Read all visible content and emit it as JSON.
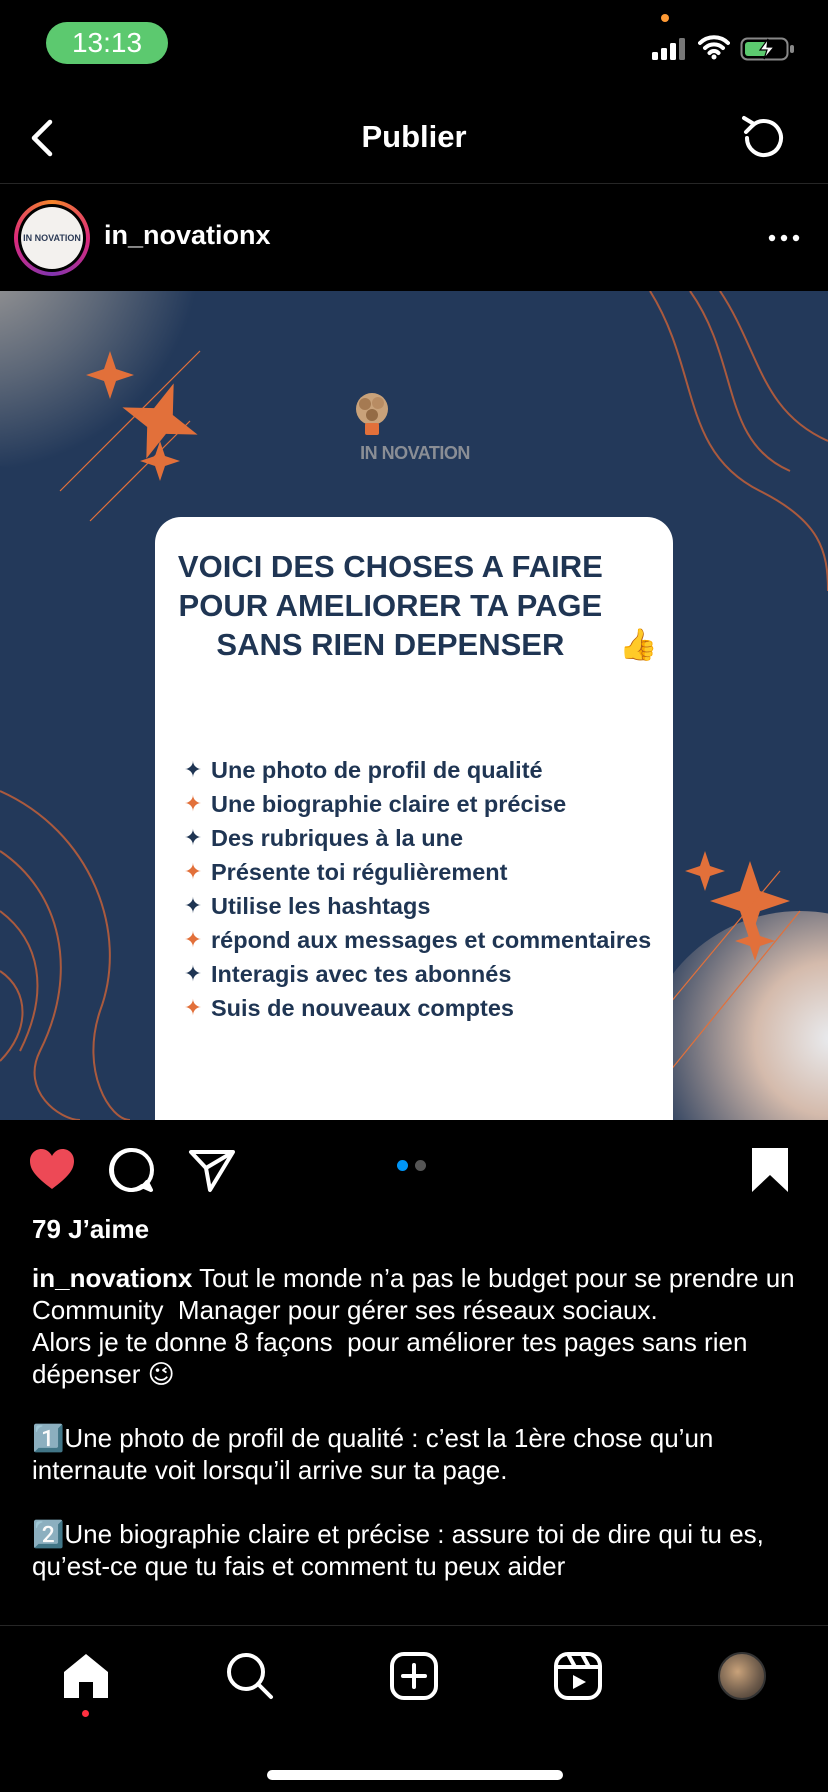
{
  "status_bar": {
    "time": "13:13"
  },
  "header": {
    "title": "Publier"
  },
  "post": {
    "username": "in_novationx",
    "avatar_text": "IN NOVATION",
    "image": {
      "brand": "IN NOVATION",
      "title": "VOICI DES CHOSES A FAIRE POUR AMELIORER TA PAGE SANS RIEN DEPENSER",
      "title_emoji": "👍",
      "items": [
        "Une photo de profil de qualité",
        "Une biographie claire et précise",
        "Des rubriques à la une",
        "Présente toi régulièrement",
        "Utilise les hashtags",
        "répond aux messages et commentaires",
        "Interagis avec tes abonnés",
        "Suis de nouveaux comptes"
      ]
    },
    "likes": "79 J’aime",
    "caption_user": "in_novationx",
    "caption_text": " Tout le monde n’a pas le budget pour se prendre un Community  Manager pour gérer ses réseaux sociaux.\nAlors je te donne 8 façons  pour améliorer tes pages sans rien dépenser 😉\n\n1️⃣Une photo de profil de qualité : c’est la 1ère chose qu’un internaute voit lorsqu’il arrive sur ta page.\n\n2️⃣Une biographie claire et précise : assure toi de dire qui tu es, qu’est-ce que tu fais et comment tu peux aider"
  },
  "colors": {
    "accent_blue": "#0095f6",
    "like_red": "#ed4956",
    "card_navy": "#1f3553",
    "post_bg": "#23395a",
    "orange": "#e2703a"
  },
  "icons": {
    "like": "heart-icon",
    "comment": "comment-icon",
    "share": "send-icon",
    "save": "bookmark-icon",
    "nav": [
      "home-icon",
      "search-icon",
      "add-icon",
      "reels-icon",
      "profile-avatar"
    ]
  },
  "carousel": {
    "total": 2,
    "current": 1
  }
}
